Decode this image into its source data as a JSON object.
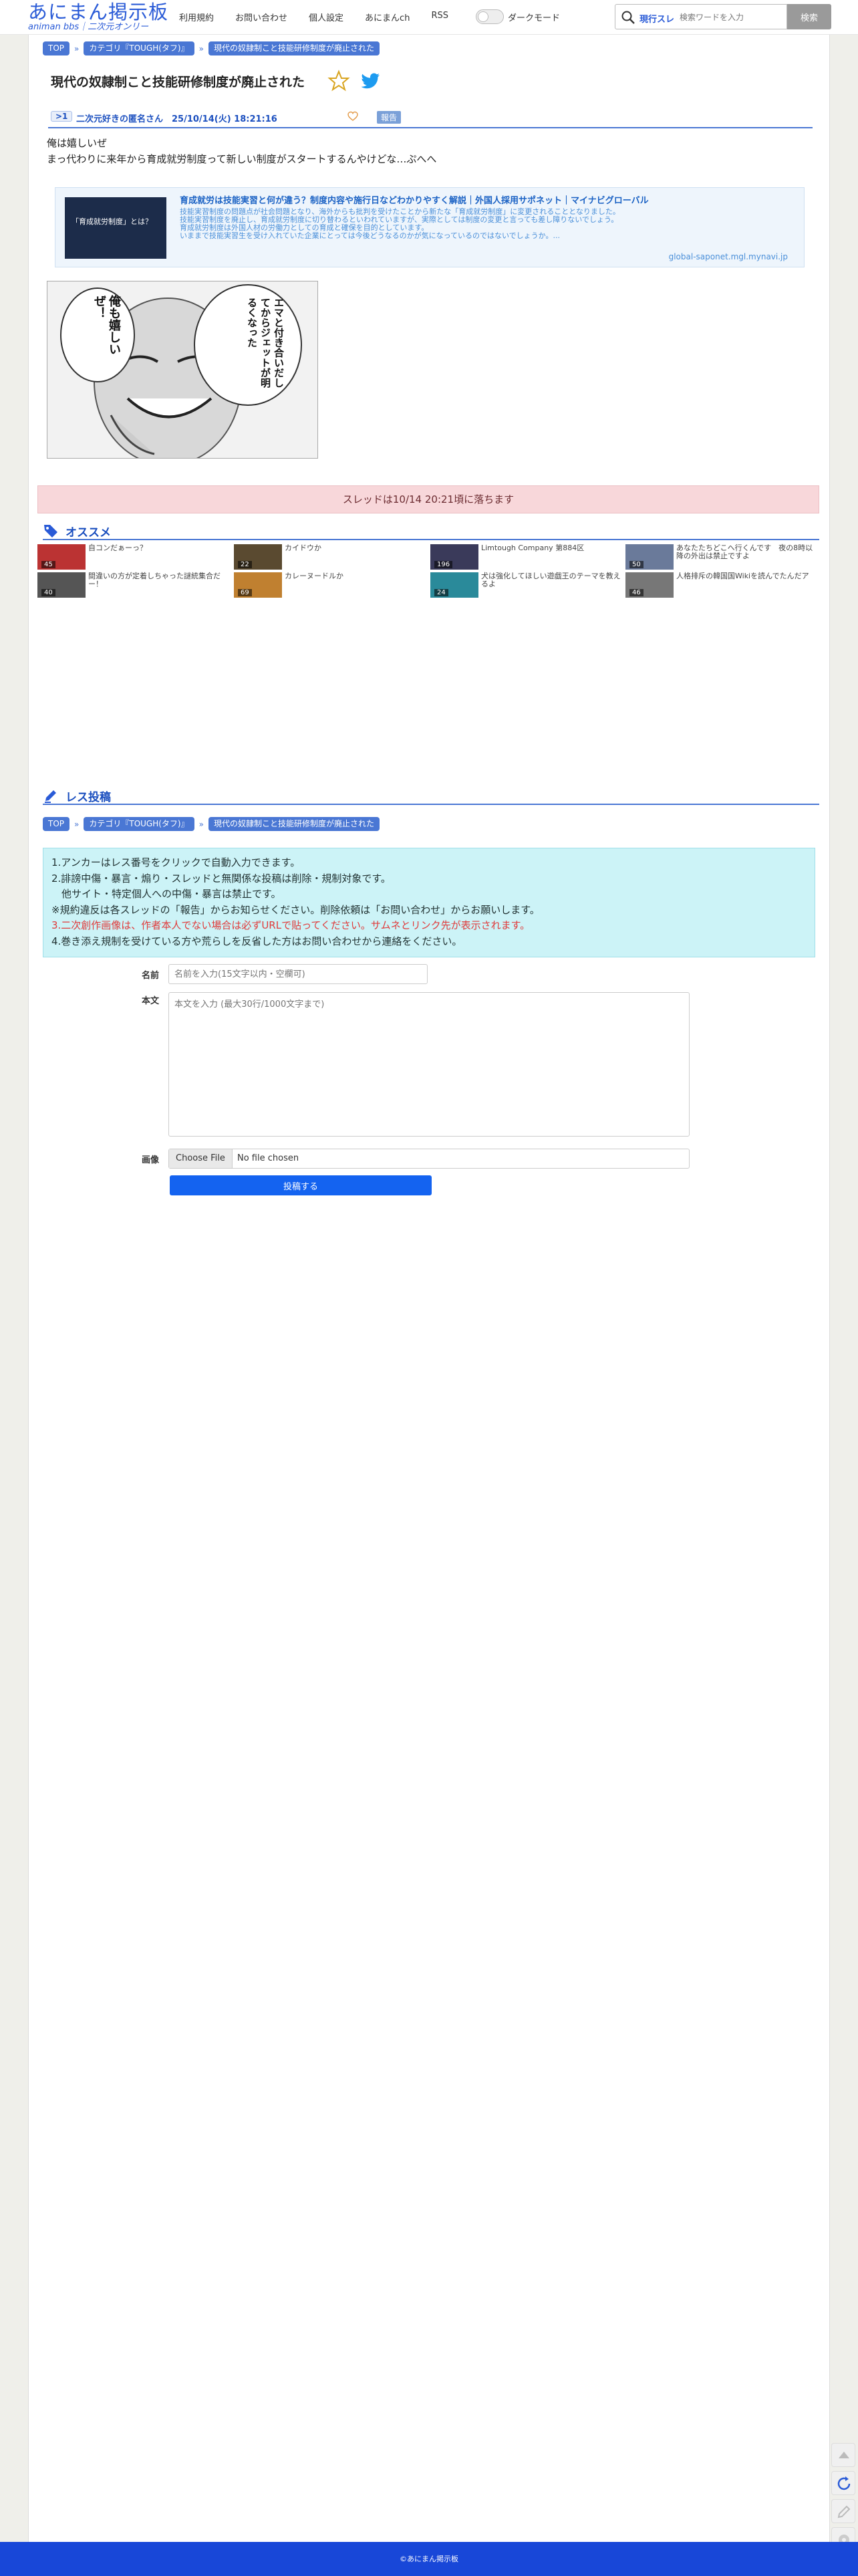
{
  "site": {
    "logo_main": "あにまん掲示板",
    "logo_sub": "animan bbs｜二次元オンリー",
    "nav": [
      "利用規約",
      "お問い合わせ",
      "個人設定",
      "あにまんch",
      "RSS"
    ],
    "dark_mode_label": "ダークモード",
    "search_scope": "現行スレ",
    "search_placeholder": "検索ワードを入力",
    "search_button": "検索"
  },
  "breadcrumb": {
    "top": "TOP",
    "category": "カテゴリ『TOUGH(タフ)』",
    "current": "現代の奴隷制こと技能研修制度が廃止された"
  },
  "thread": {
    "title": "現代の奴隷制こと技能研修制度が廃止された",
    "post": {
      "number": ">1",
      "meta": "二次元好きの匿名さん　25/10/14(火) 18:21:16",
      "report": "報告",
      "lines": [
        "俺は嬉しいぜ",
        "まっ代わりに来年から育成就労制度って新しい制度がスタートするんやけどな…ぷへへ"
      ]
    },
    "image_speech_right": "エマと付き合いだしてからジェットが明るくなった",
    "image_speech_left": "俺も嬉しいぜ！"
  },
  "ad": {
    "thumb_text": "「育成就労制度」とは？",
    "title": "育成就労は技能実習と何が違う？制度内容や施行日などわかりやすく解説｜外国人採用サポネット｜マイナビグローバル",
    "desc": "技能実習制度の問題点が社会問題となり、海外からも批判を受けたことから新たな「育成就労制度」に変更されることとなりました。\n技能実習制度を廃止し、育成就労制度に切り替わるといわれていますが、実際としては制度の変更と言っても差し障りないでしょう。\n育成就労制度は外国人材の労働力としての育成と確保を目的としています。\nいままで技能実習生を受け入れていた企業にとっては今後どうなるのかが気になっているのではないでしょうか。...",
    "domain": "global-saponet.mgl.mynavi.jp"
  },
  "drop_notice": "スレッドは10/14 20:21頃に落ちます",
  "recommend": {
    "heading": "オススメ",
    "items": [
      {
        "count": "45",
        "title": "自コンだぁーっ？",
        "color": "#b33"
      },
      {
        "count": "22",
        "title": "カイドウか",
        "color": "#5a4a30"
      },
      {
        "count": "196",
        "title": "Limtough Company 第884区",
        "color": "#3a3a5a"
      },
      {
        "count": "50",
        "title": "あなたたちどこへ行くんです　夜の8時以降の外出は禁止ですよ",
        "color": "#6a7a9a"
      },
      {
        "count": "40",
        "title": "間違いの方が定着しちゃった謎統集合だー！",
        "color": "#555"
      },
      {
        "count": "69",
        "title": "カレーヌードルか",
        "color": "#c08030"
      },
      {
        "count": "24",
        "title": "犬は強化してほしい遊戯王のテーマを教えるよ",
        "color": "#2a8a9a"
      },
      {
        "count": "46",
        "title": "人格排斥の韓国国Wikiを読んでたんだア",
        "color": "#777"
      }
    ]
  },
  "post_form": {
    "heading": "レス投稿",
    "rules": [
      "1.アンカーはレス番号をクリックで自動入力できます。",
      "2.誹謗中傷・暴言・煽り・スレッドと無関係な投稿は削除・規制対象です。",
      "　他サイト・特定個人への中傷・暴言は禁止です。",
      "※規約違反は各スレッドの「報告」からお知らせください。削除依頼は「お問い合わせ」からお願いします。",
      "3.二次創作画像は、作者本人でない場合は必ずURLで貼ってください。サムネとリンク先が表示されます。",
      "4.巻き添え規制を受けている方や荒らしを反省した方はお問い合わせから連絡をください。"
    ],
    "name_label": "名前",
    "name_placeholder": "名前を入力(15文字以内・空欄可)",
    "body_label": "本文",
    "body_placeholder": "本文を入力 (最大30行/1000文字まで)",
    "image_label": "画像",
    "file_button": "Choose File",
    "file_none": "No file chosen",
    "submit": "投稿する"
  },
  "footer": "©あにまん掲示板",
  "colors": {
    "accent": "#4a77d4",
    "brand": "#2a5bd7",
    "footer": "#1847d8",
    "submit": "#1463f0"
  }
}
